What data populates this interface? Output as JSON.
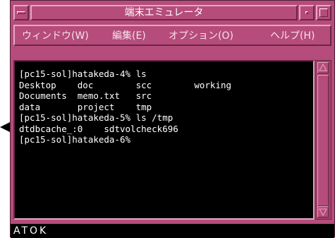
{
  "window": {
    "title": "端末エミュレータ"
  },
  "menubar": {
    "items": [
      {
        "label": "ウィンドウ(W)"
      },
      {
        "label": "編集(E)"
      },
      {
        "label": "オプション(O)"
      },
      {
        "label": "ヘルプ(H)"
      }
    ]
  },
  "terminal": {
    "lines": [
      "[pc15-sol]hatakeda-4% ls",
      "Desktop    doc        scc        working",
      "Documents  memo.txt   src",
      "data       project    tmp",
      "[pc15-sol]hatakeda-5% ls /tmp",
      "dtdbcache_:0    sdtvolcheck696",
      "[pc15-sol]hatakeda-6%"
    ]
  },
  "statusbar": {
    "text": "ATOK"
  },
  "colors": {
    "frame": "#b64c7b",
    "terminal_bg": "#000000",
    "terminal_fg": "#ffffff"
  },
  "icons": {
    "pointer": "arrow-right-icon",
    "window_menu": "window-menu-icon",
    "minimize": "minimize-icon",
    "maximize": "maximize-icon",
    "scroll_up": "scroll-up-icon",
    "scroll_down": "scroll-down-icon"
  }
}
